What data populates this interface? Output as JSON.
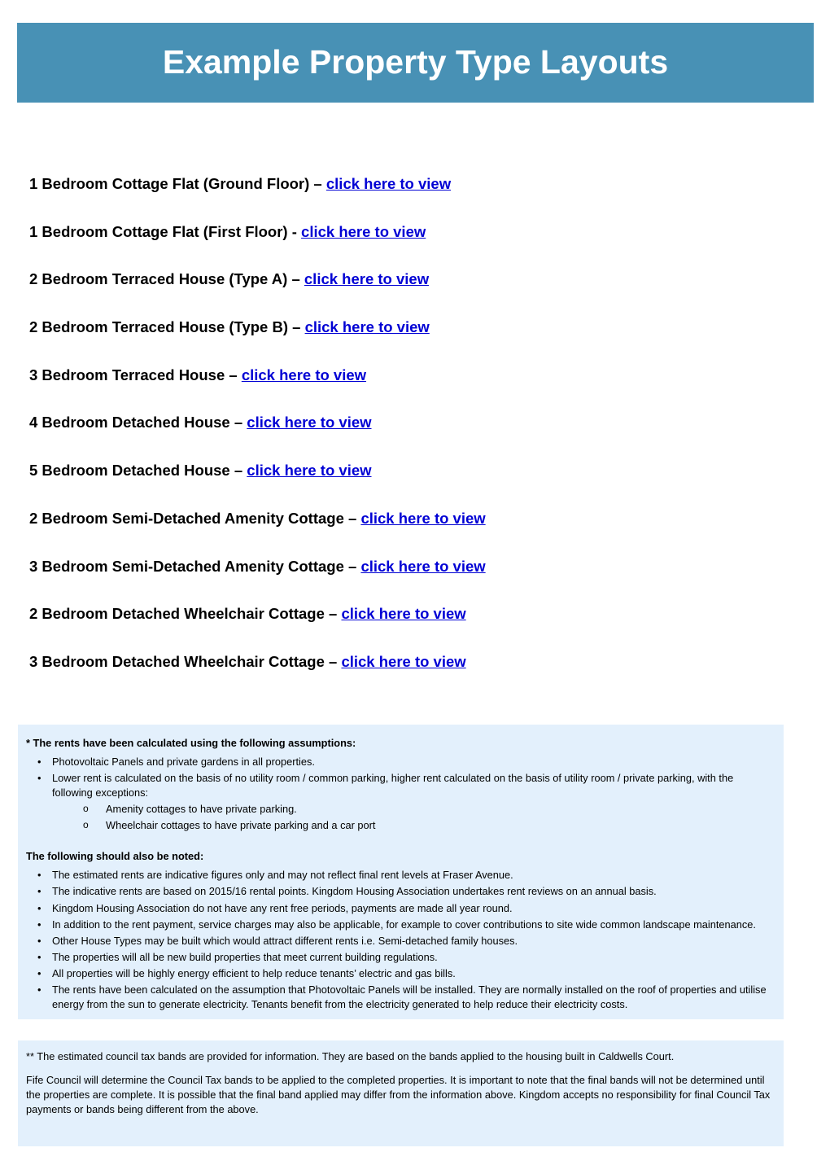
{
  "header": {
    "title": "Example Property Type Layouts",
    "background_color": "#4891b5",
    "text_color": "#ffffff"
  },
  "colors": {
    "link": "#0000d4",
    "panel_background": "#e3f0fc",
    "page_background": "#ffffff"
  },
  "layouts": {
    "items": [
      {
        "label": "1 Bedroom Cottage Flat (Ground Floor) – ",
        "link": "click here to view"
      },
      {
        "label": "1 Bedroom Cottage Flat (First Floor) - ",
        "link": "click here to view"
      },
      {
        "label": "2 Bedroom Terraced House (Type A) – ",
        "link": "click here to view"
      },
      {
        "label": "2 Bedroom Terraced House (Type B) – ",
        "link": "click here to view"
      },
      {
        "label": "3 Bedroom Terraced House – ",
        "link": "click here to view"
      },
      {
        "label": "4 Bedroom Detached House – ",
        "link": "click here to view"
      },
      {
        "label": "5 Bedroom Detached House – ",
        "link": "click here to view"
      },
      {
        "label": "2 Bedroom Semi-Detached Amenity Cottage – ",
        "link": "click here to view"
      },
      {
        "label": "3  Bedroom Semi-Detached Amenity Cottage – ",
        "link": "click here to view"
      },
      {
        "label": "2 Bedroom Detached Wheelchair Cottage – ",
        "link": "click here to view"
      },
      {
        "label": "3 Bedroom Detached Wheelchair Cottage – ",
        "link": "click here to view"
      }
    ]
  },
  "assumptions": {
    "heading": "* The rents have been calculated using the following assumptions:",
    "bullets": [
      "Photovoltaic Panels and private  gardens in all properties.",
      "Lower rent is calculated on the basis of no utility room / common parking, higher rent calculated on the basis of utility room / private parking, with the following exceptions:"
    ],
    "sub_bullets": [
      "Amenity cottages to have private parking.",
      "Wheelchair cottages to have private parking and a car port"
    ],
    "noted_heading": "The following should also be noted:",
    "noted_bullets": [
      "The estimated rents are indicative figures only and may not reflect final rent levels at Fraser Avenue.",
      "The indicative rents are based on 2015/16 rental points.  Kingdom Housing Association undertakes rent reviews on an annual basis.",
      "Kingdom Housing Association do not have any rent free periods, payments are made all year round.",
      "In addition to the rent payment, service charges may also be applicable, for example to cover contributions to site wide common landscape maintenance.",
      "Other House Types may be built which would attract different rents i.e. Semi-detached family houses.",
      "The properties will all be new build properties that meet current building regulations.",
      "All properties will be highly energy efficient to help reduce tenants’ electric and gas bills.",
      "The rents have been calculated on the assumption that Photovoltaic Panels will be installed.  They are normally installed on the roof of properties and utilise energy from the sun to generate electricity.  Tenants benefit from the electricity generated to help reduce their electricity costs."
    ],
    "bullet_marker": "•",
    "sub_bullet_marker": "o"
  },
  "council_tax": {
    "paragraph_1": "** The estimated council tax bands are provided for information.  They are based on the bands applied to the housing built in Caldwells Court.",
    "paragraph_2": "Fife Council will determine the Council Tax bands to be applied to the completed properties.  It is important to note that the final bands will not be determined until the properties are complete.  It is possible that the final band applied may differ from the information above.  Kingdom accepts no responsibility for final Council Tax payments or bands being different from the above."
  }
}
